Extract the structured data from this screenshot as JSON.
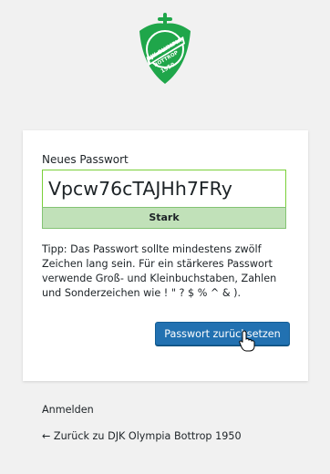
{
  "logo": {
    "text_top": "DJK OLYMPIA",
    "text_bottom": "BOTTROP",
    "year": "1950",
    "colors": {
      "green": "#1fa64a",
      "white": "#ffffff"
    }
  },
  "form": {
    "label": "Neues Passwort",
    "password_value": "Vpcw76cTAJHh7FRy",
    "strength": "Stark",
    "hint": "Tipp: Das Passwort sollte mindestens zwölf Zeichen lang sein. Für ein stärkeres Passwort verwende Groß- und Kleinbuchstaben, Zahlen und Sonderzeichen wie ! \" ? $ % ^ & ).",
    "submit_label": "Passwort zurücksetzen"
  },
  "nav": {
    "login": "Anmelden",
    "back": "← Zurück zu DJK Olympia Bottrop 1950"
  },
  "colors": {
    "accent": "#2271b1",
    "strong_bg": "#c1e1b9",
    "strong_border": "#83c373",
    "input_border": "#7ad03a"
  }
}
